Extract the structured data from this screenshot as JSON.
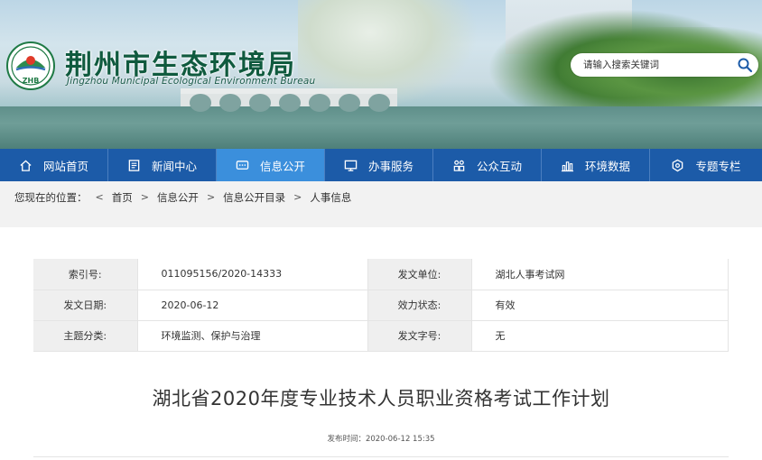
{
  "header": {
    "site_title": "荆州市生态环境局",
    "site_subtitle": "Jingzhou Municipal Ecological Environment Bureau",
    "logo_text": "ZHB",
    "search_placeholder": "请输入搜索关键词"
  },
  "nav": {
    "items": [
      {
        "label": "网站首页",
        "icon": "home-icon"
      },
      {
        "label": "新闻中心",
        "icon": "news-icon"
      },
      {
        "label": "信息公开",
        "icon": "chat-icon",
        "active": true
      },
      {
        "label": "办事服务",
        "icon": "monitor-icon"
      },
      {
        "label": "公众互动",
        "icon": "people-icon"
      },
      {
        "label": "环境数据",
        "icon": "chart-icon"
      },
      {
        "label": "专题专栏",
        "icon": "settings-icon"
      }
    ]
  },
  "breadcrumb": {
    "prefix": "您现在的位置：",
    "items": [
      "首页",
      "信息公开",
      "信息公开目录",
      "人事信息"
    ]
  },
  "meta": {
    "rows": [
      {
        "l1": "索引号:",
        "v1": "011095156/2020-14333",
        "l2": "发文单位:",
        "v2": "湖北人事考试网"
      },
      {
        "l1": "发文日期:",
        "v1": "2020-06-12",
        "l2": "效力状态:",
        "v2": "有效"
      },
      {
        "l1": "主题分类:",
        "v1": "环境监测、保护与治理",
        "l2": "发文字号:",
        "v2": "无"
      }
    ]
  },
  "article": {
    "title": "湖北省2020年度专业技术人员职业资格考试工作计划",
    "publish_label": "发布时间：",
    "publish_time": "2020-06-12 15:35"
  },
  "colors": {
    "nav_bg": "#1c5ba8",
    "nav_active": "#3b8fdc",
    "title_green": "#0f5a3e"
  }
}
